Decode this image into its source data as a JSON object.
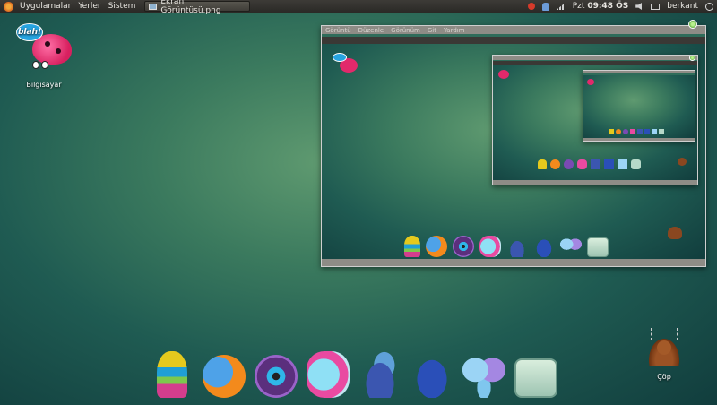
{
  "top_panel": {
    "menus": [
      "Uygulamalar",
      "Yerler",
      "Sistem"
    ],
    "task_button": "Ekran Görüntüsü.png",
    "day": "Pzt",
    "time": "09:48 ÖS",
    "user": "berkant",
    "icons": [
      "ubuntu-logo-icon",
      "alert-icon",
      "user-icon",
      "network-icon",
      "volume-icon",
      "mail-icon",
      "power-icon"
    ]
  },
  "desktop": {
    "computer_icon_label": "Bilgisayar",
    "computer_icon_bubble": "blah!",
    "trash_label": "Çöp"
  },
  "screenshot_window": {
    "menus": [
      "Görüntü",
      "Düzenle",
      "Görünüm",
      "Git",
      "Yardım"
    ]
  },
  "dock": {
    "apps": [
      "owl-icon",
      "firefox-icon",
      "eye-icon",
      "coin-icon",
      "frog-icon",
      "frog-blue-icon",
      "butterfly-icon",
      "bag-icon"
    ]
  }
}
